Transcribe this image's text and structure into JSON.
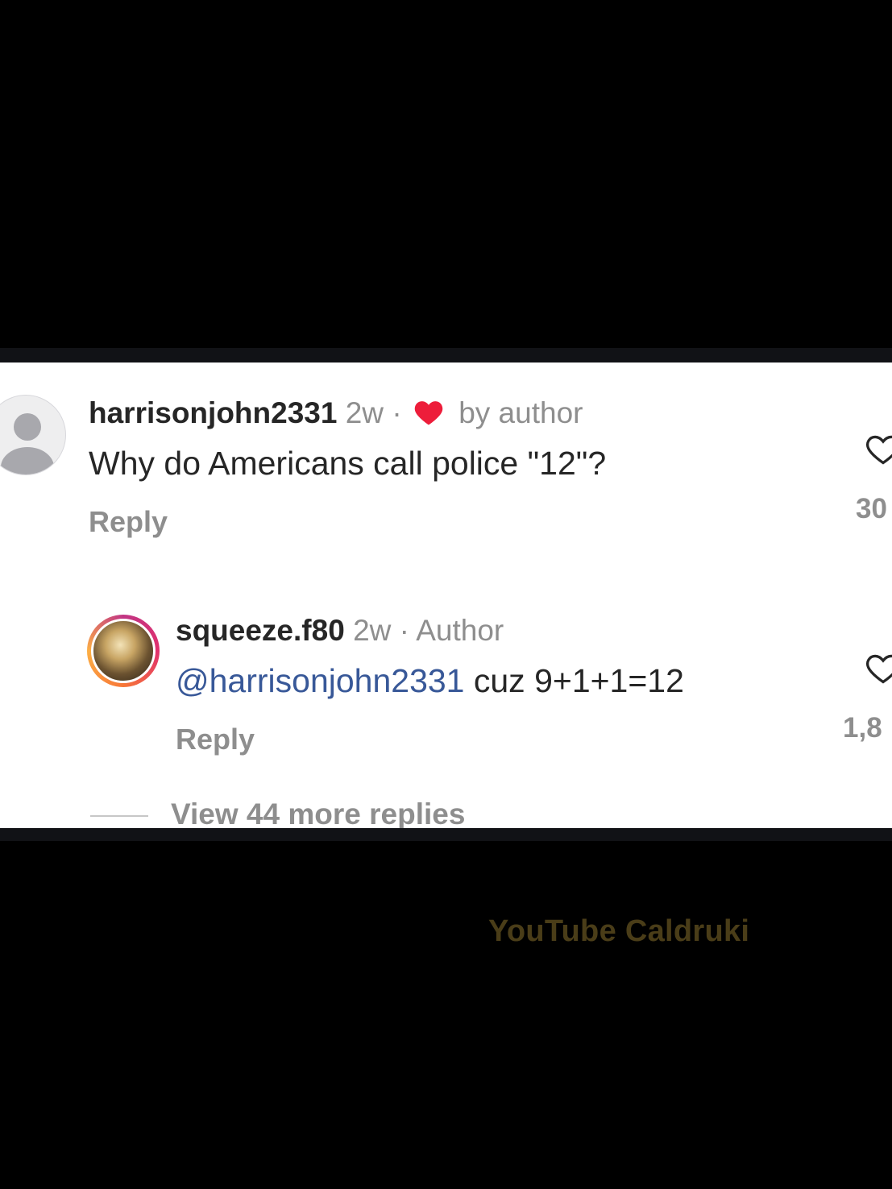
{
  "comments": [
    {
      "username": "harrisonjohn2331",
      "time": "2w",
      "separator": "·",
      "badge": "by author",
      "text": "Why do Americans call police \"12\"?",
      "reply_label": "Reply",
      "likes": "30",
      "avatar": "default-avatar-icon"
    },
    {
      "username": "squeeze.f80",
      "time": "2w",
      "separator": "·",
      "badge": "Author",
      "mention": "@harrisonjohn2331",
      "text": " cuz 9+1+1=12",
      "reply_label": "Reply",
      "likes": "1,8",
      "avatar": "story-ring-avatar"
    }
  ],
  "view_more": "View 44 more replies",
  "watermark": "YouTube Caldruki",
  "colors": {
    "liked_heart": "#ed1d3a",
    "mention": "#385898",
    "muted": "#8e8e8e",
    "text": "#262626"
  }
}
